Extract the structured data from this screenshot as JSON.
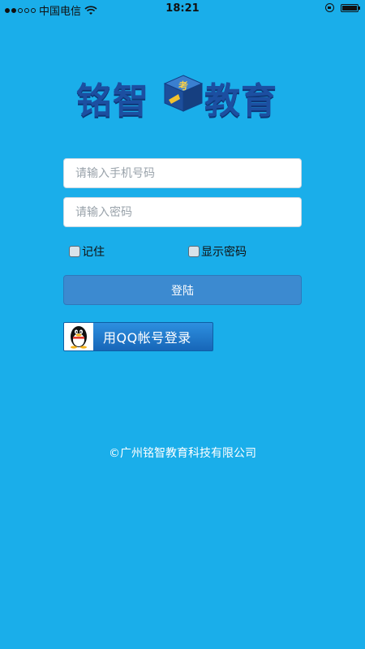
{
  "status_bar": {
    "carrier": "中国电信",
    "time": "18:21",
    "signal_bars_filled": 2,
    "signal_bars_total": 5
  },
  "logo": {
    "left_text": "铭智",
    "right_text": "教育",
    "cube_text": "考"
  },
  "form": {
    "phone_placeholder": "请输入手机号码",
    "phone_value": "",
    "password_placeholder": "请输入密码",
    "password_value": "",
    "remember_label": "记住",
    "show_password_label": "显示密码",
    "login_label": "登陆"
  },
  "qq_login": {
    "label": "用QQ帐号登录",
    "icon": "qq-penguin-icon"
  },
  "footer": {
    "copyright": "©广州铭智教育科技有限公司"
  },
  "colors": {
    "background": "#1aaeea",
    "login_button": "#3c8ad0",
    "logo_blue": "#1c4fa1"
  }
}
